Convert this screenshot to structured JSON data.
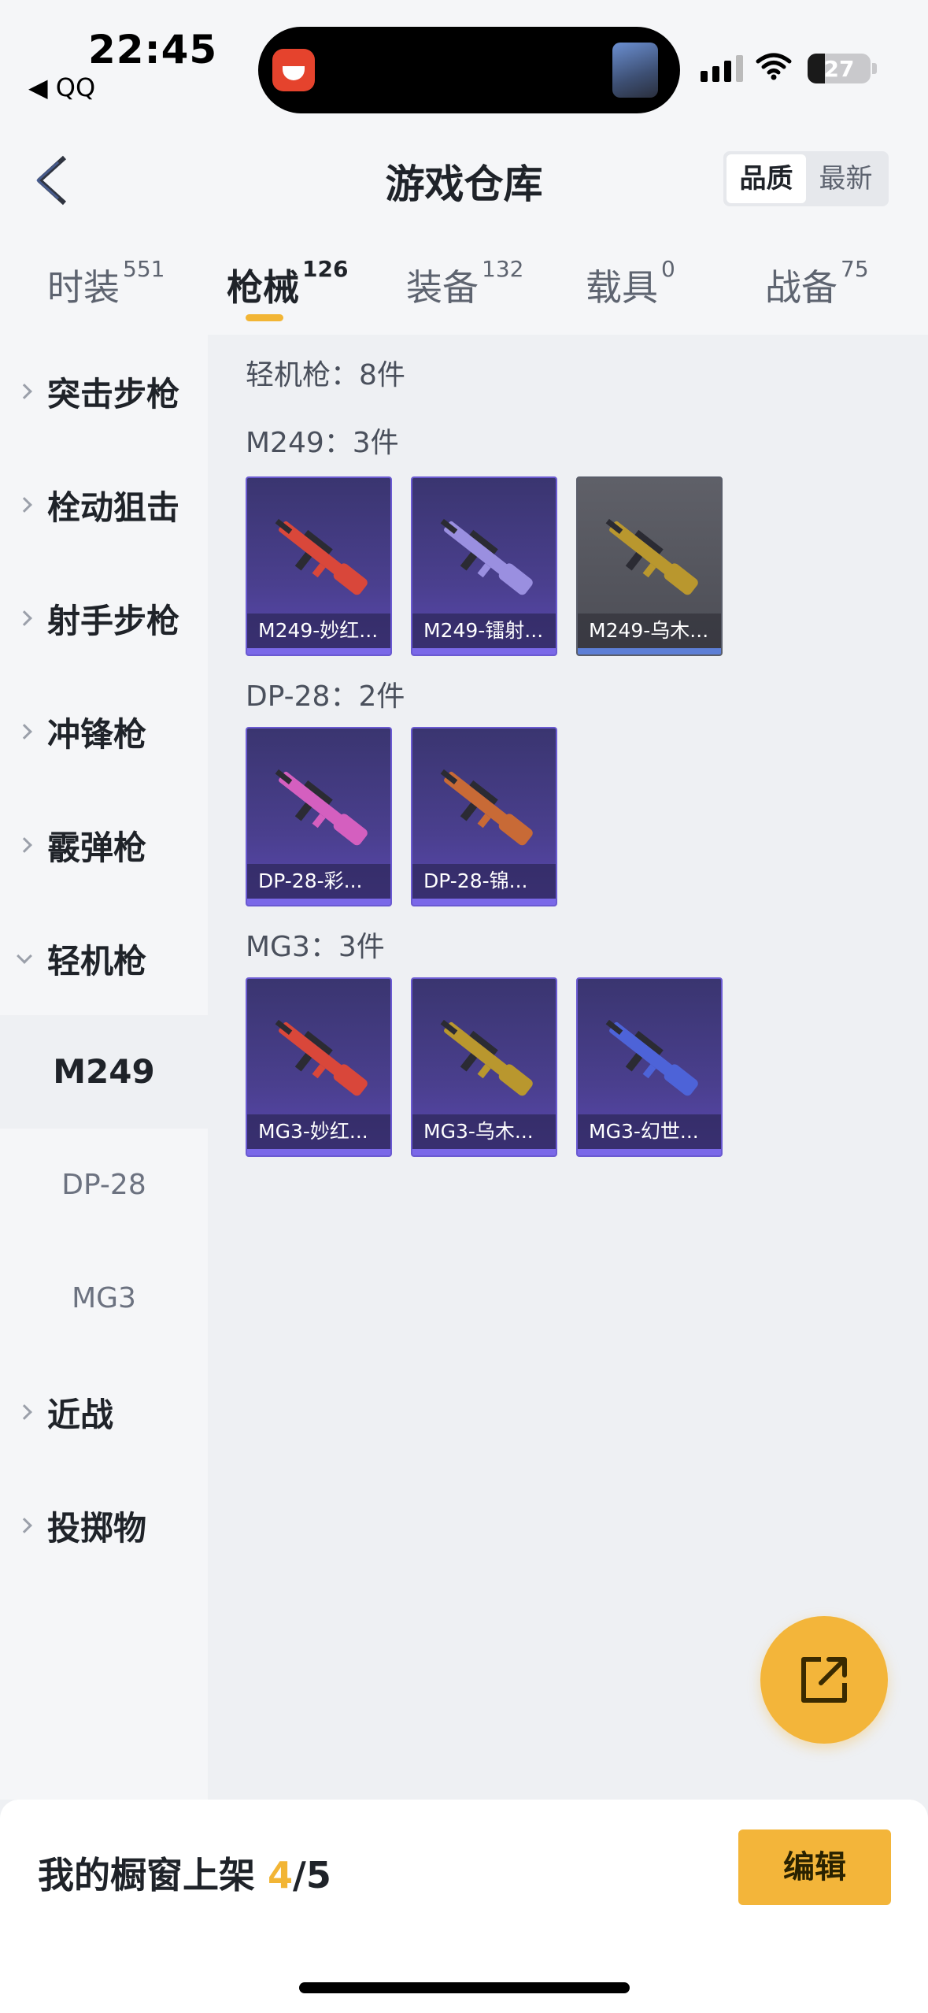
{
  "status_bar": {
    "time": "22:45",
    "back_app": "◀ QQ",
    "battery": "27",
    "battery_level": 0.27
  },
  "nav": {
    "title": "游戏仓库",
    "sort_options": [
      "品质",
      "最新"
    ],
    "sort_selected": "品质"
  },
  "tabs": [
    {
      "label": "时装",
      "count": "551"
    },
    {
      "label": "枪械",
      "count": "126"
    },
    {
      "label": "装备",
      "count": "132"
    },
    {
      "label": "载具",
      "count": "0"
    },
    {
      "label": "战备",
      "count": "75"
    }
  ],
  "active_tab": "枪械",
  "sidebar": {
    "items": [
      {
        "label": "突击步枪"
      },
      {
        "label": "栓动狙击"
      },
      {
        "label": "射手步枪"
      },
      {
        "label": "冲锋枪"
      },
      {
        "label": "霰弹枪"
      },
      {
        "label": "轻机枪"
      },
      {
        "label": "近战"
      },
      {
        "label": "投掷物"
      }
    ],
    "sub_items": [
      {
        "label": "M249"
      },
      {
        "label": "DP-28"
      },
      {
        "label": "MG3"
      }
    ],
    "active_sub": "M249"
  },
  "main": {
    "category_title": "轻机枪：8件",
    "groups": [
      {
        "title": "M249：3件",
        "items": [
          {
            "label": "M249-妙红...",
            "color": "#d9473a"
          },
          {
            "label": "M249-镭射...",
            "color": "#9a8fe0"
          },
          {
            "label": "M249-乌木...",
            "color": "#b9972e"
          }
        ]
      },
      {
        "title": "DP-28：2件",
        "items": [
          {
            "label": "DP-28-彩...",
            "color": "#d45fbf"
          },
          {
            "label": "DP-28-锦...",
            "color": "#c86a36"
          }
        ]
      },
      {
        "title": "MG3：3件",
        "items": [
          {
            "label": "MG3-妙红...",
            "color": "#d9473a"
          },
          {
            "label": "MG3-乌木...",
            "color": "#b9972e"
          },
          {
            "label": "MG3-幻世...",
            "color": "#4d63d8"
          }
        ]
      }
    ]
  },
  "bottom": {
    "showcase_prefix": "我的橱窗上架 ",
    "showcase_count": "4",
    "showcase_total": "/5",
    "edit_label": "编辑"
  }
}
